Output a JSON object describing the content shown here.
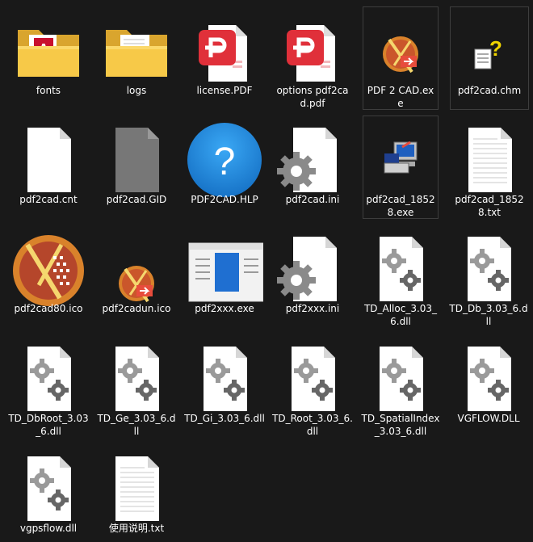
{
  "files": [
    {
      "name": "fonts",
      "icon": "folder-icon"
    },
    {
      "name": "logs",
      "icon": "folder-icon"
    },
    {
      "name": "license.PDF",
      "icon": "pdf-icon"
    },
    {
      "name": "options pdf2cad.pdf",
      "icon": "pdf-icon"
    },
    {
      "name": "PDF 2 CAD.exe",
      "icon": "pdf2cad-app-icon"
    },
    {
      "name": "pdf2cad.chm",
      "icon": "chm-help-icon"
    },
    {
      "name": "pdf2cad.cnt",
      "icon": "blank-file-icon"
    },
    {
      "name": "pdf2cad.GID",
      "icon": "gray-file-icon"
    },
    {
      "name": "PDF2CAD.HLP",
      "icon": "help-question-icon"
    },
    {
      "name": "pdf2cad.ini",
      "icon": "settings-file-icon"
    },
    {
      "name": "pdf2cad_18528.exe",
      "icon": "installer-icon"
    },
    {
      "name": "pdf2cad_18528.txt",
      "icon": "text-file-icon"
    },
    {
      "name": "pdf2cad80.ico",
      "icon": "pdf2cad-large-icon"
    },
    {
      "name": "pdf2cadun.ico",
      "icon": "pdf2cad-app-icon"
    },
    {
      "name": "pdf2xxx.exe",
      "icon": "window-app-icon"
    },
    {
      "name": "pdf2xxx.ini",
      "icon": "settings-file-icon"
    },
    {
      "name": "TD_Alloc_3.03_6.dll",
      "icon": "dll-gears-icon"
    },
    {
      "name": "TD_Db_3.03_6.dll",
      "icon": "dll-gears-icon"
    },
    {
      "name": "TD_DbRoot_3.03_6.dll",
      "icon": "dll-gears-icon"
    },
    {
      "name": "TD_Ge_3.03_6.dll",
      "icon": "dll-gears-icon"
    },
    {
      "name": "TD_Gi_3.03_6.dll",
      "icon": "dll-gears-icon"
    },
    {
      "name": "TD_Root_3.03_6.dll",
      "icon": "dll-gears-icon"
    },
    {
      "name": "TD_SpatialIndex_3.03_6.dll",
      "icon": "dll-gears-icon"
    },
    {
      "name": "VGFLOW.DLL",
      "icon": "dll-gears-icon"
    },
    {
      "name": "vgpsflow.dll",
      "icon": "dll-gears-icon"
    },
    {
      "name": "使用说明.txt",
      "icon": "text-file-icon"
    }
  ],
  "colors": {
    "background": "#191919",
    "selection_border": "#3d3d3d",
    "folder": "#f5c542",
    "pdf_red": "#e0303a",
    "help_blue": "#1e90e6"
  }
}
